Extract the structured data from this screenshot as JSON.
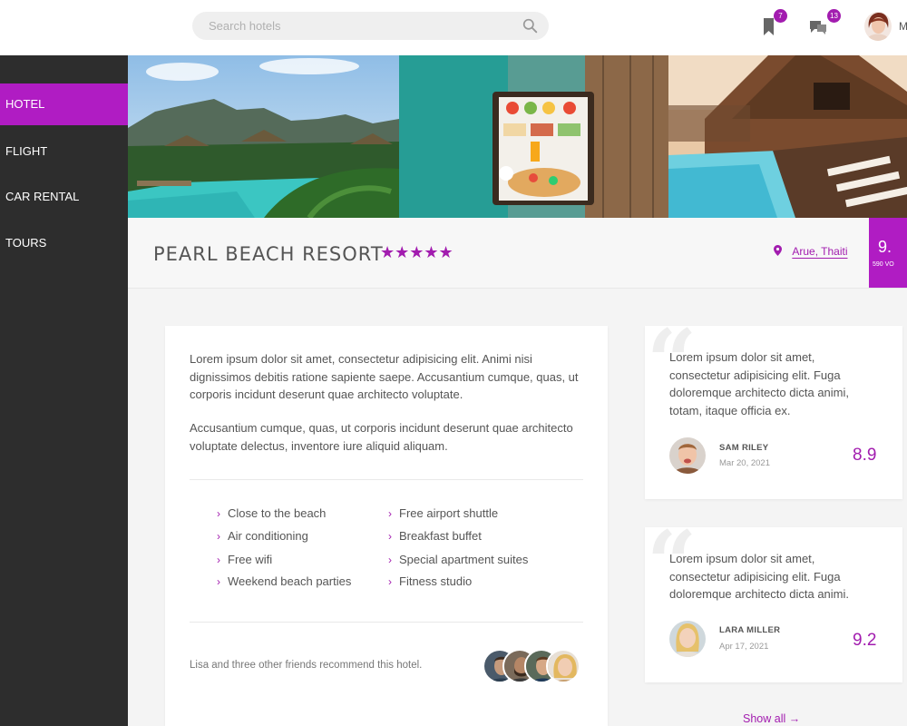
{
  "header": {
    "search_placeholder": "Search hotels",
    "bookmarks_badge": "7",
    "messages_badge": "13",
    "user_initial": "M"
  },
  "sidebar": {
    "items": [
      {
        "label": "HOTEL",
        "active": true
      },
      {
        "label": "FLIGHT",
        "active": false
      },
      {
        "label": "CAR RENTAL",
        "active": false
      },
      {
        "label": "TOURS",
        "active": false
      }
    ]
  },
  "hotel": {
    "name": "PEARL BEACH RESORT",
    "stars": "★★★★★",
    "location": "Arue, Thaiti",
    "score": "9.",
    "votes": "590 VO"
  },
  "description": {
    "paragraph1": "Lorem ipsum dolor sit amet, consectetur adipisicing elit. Animi nisi dignissimos debitis ratione sapiente saepe. Accusantium cumque, quas, ut corporis incidunt deserunt quae architecto voluptate.",
    "paragraph2": "Accusantium cumque, quas, ut corporis incidunt deserunt quae architecto voluptate delectus, inventore iure aliquid aliquam."
  },
  "features": {
    "left": [
      "Close to the beach",
      "Air conditioning",
      "Free wifi",
      "Weekend beach parties"
    ],
    "right": [
      "Free airport shuttle",
      "Breakfast buffet",
      "Special apartment suites",
      "Fitness studio"
    ]
  },
  "recommend_text": "Lisa and three other friends recommend this hotel.",
  "reviews": [
    {
      "text": "Lorem ipsum dolor sit amet, consectetur adipisicing elit. Fuga doloremque architecto dicta animi, totam, itaque officia ex.",
      "name": "SAM RILEY",
      "date": "Mar 20, 2021",
      "score": "8.9"
    },
    {
      "text": "Lorem ipsum dolor sit amet, consectetur adipisicing elit. Fuga doloremque architecto dicta animi.",
      "name": "LARA MILLER",
      "date": "Apr 17, 2021",
      "score": "9.2"
    }
  ],
  "show_all": "Show all →",
  "colors": {
    "accent": "#a21caf",
    "sidebar_bg": "#2d2d2d"
  }
}
